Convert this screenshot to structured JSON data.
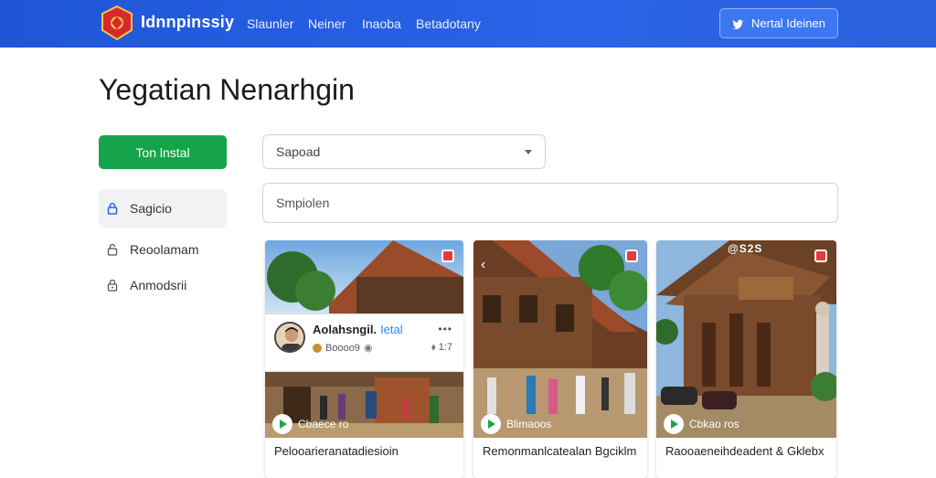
{
  "header": {
    "brand": "Idnnpinssiy",
    "nav": [
      "Slaunler",
      "Neiner",
      "Inaoba",
      "Betadotany"
    ],
    "action_label": "Nertal Ideinen"
  },
  "page": {
    "title": "Yegatian Nenarhgin"
  },
  "sidebar": {
    "primary_label": "Ton lnstal",
    "items": [
      {
        "label": "Sagicio",
        "active": true
      },
      {
        "label": "Reoolamam",
        "active": false
      },
      {
        "label": "Anmodsrii",
        "active": false
      }
    ]
  },
  "filters": {
    "select_value": "Sapoad",
    "input_placeholder": "Smpiolen"
  },
  "cards": [
    {
      "caption": "Pelooarieranatadiesioin",
      "play_label": "Cbaece ro",
      "overlay": {
        "username": "Aolahsngil.",
        "tag": "Ietal",
        "stat_left": "Boooo9",
        "stat_right": "1:7"
      }
    },
    {
      "caption": "Remonmanlcatealan Bgciklm",
      "play_label": "Blimaoos"
    },
    {
      "caption": "Raooaeneihdeadent & Gklebx",
      "play_label": "Cbkao ros",
      "top_label": "@S2S"
    }
  ],
  "colors": {
    "header": "#2a63e6",
    "primary": "#16a44a",
    "accent": "#1c8cff"
  }
}
